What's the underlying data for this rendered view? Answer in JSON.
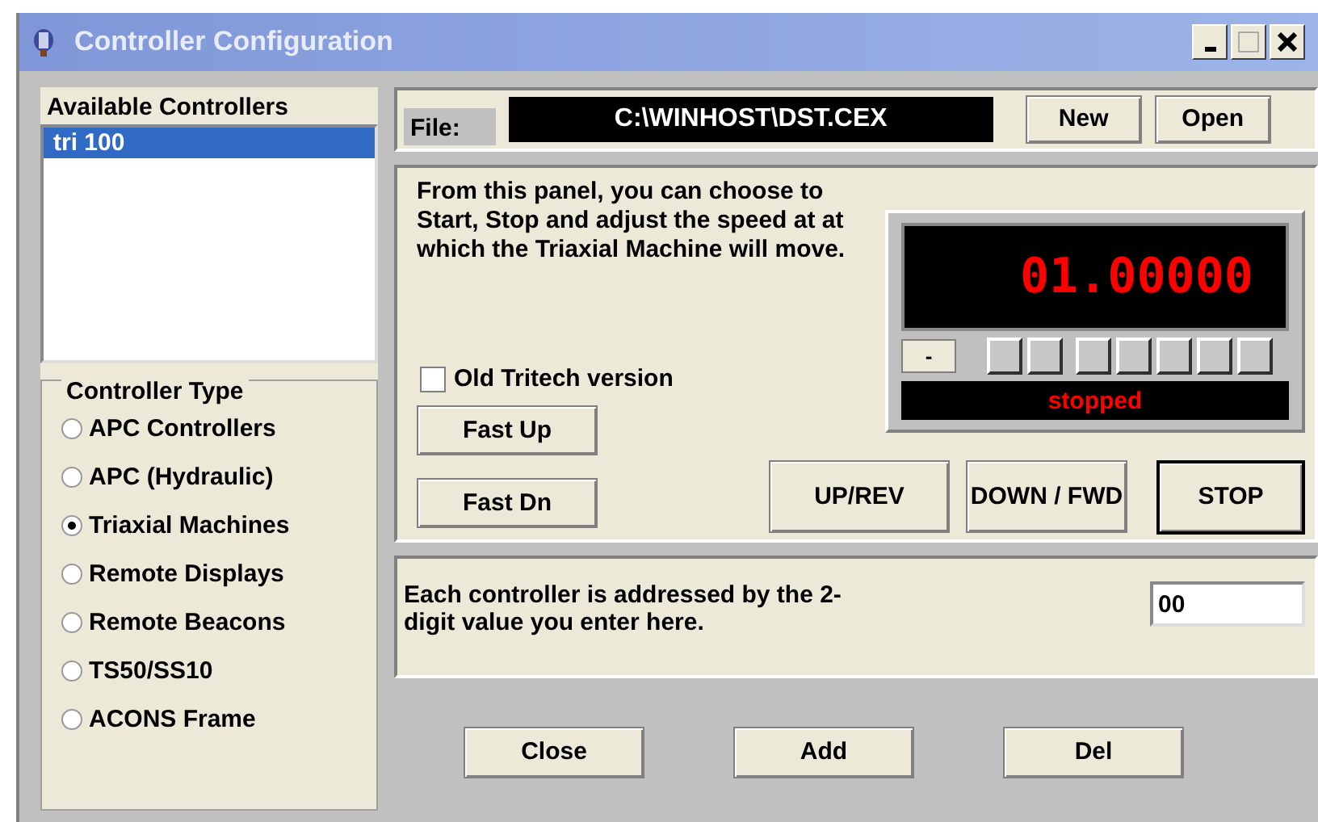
{
  "window": {
    "title": "Controller Configuration"
  },
  "available_controllers": {
    "label": "Available Controllers",
    "items": [
      {
        "label": "tri 100",
        "selected": true
      }
    ]
  },
  "controller_type": {
    "label": "Controller Type",
    "options": [
      {
        "label": "APC Controllers",
        "selected": false
      },
      {
        "label": "APC (Hydraulic)",
        "selected": false
      },
      {
        "label": "Triaxial Machines",
        "selected": true
      },
      {
        "label": "Remote Displays",
        "selected": false
      },
      {
        "label": "Remote Beacons",
        "selected": false
      },
      {
        "label": "TS50/SS10",
        "selected": false
      },
      {
        "label": "ACONS Frame",
        "selected": false
      }
    ]
  },
  "file": {
    "label": "File:",
    "path": "C:\\WINHOST\\DST.CEX"
  },
  "file_buttons": [
    "New",
    "Open"
  ],
  "description": "From this panel, you can choose to Start, Stop and adjust the speed at at which the Triaxial Machine will move.",
  "old_tritech": {
    "label": "Old Tritech version",
    "checked": false
  },
  "fast_buttons": [
    "Fast Up",
    "Fast Dn"
  ],
  "display": {
    "reading": "01.00000",
    "sign_button": "-",
    "status": "stopped"
  },
  "motion_buttons": [
    {
      "label": "UP/REV",
      "default": false
    },
    {
      "label": "DOWN / FWD",
      "default": false
    },
    {
      "label": "STOP",
      "default": true
    }
  ],
  "address": {
    "text": "Each controller is addressed by the 2-digit value you enter here.",
    "value": "00"
  },
  "bottom_buttons": [
    "Close",
    "Add",
    "Del"
  ]
}
